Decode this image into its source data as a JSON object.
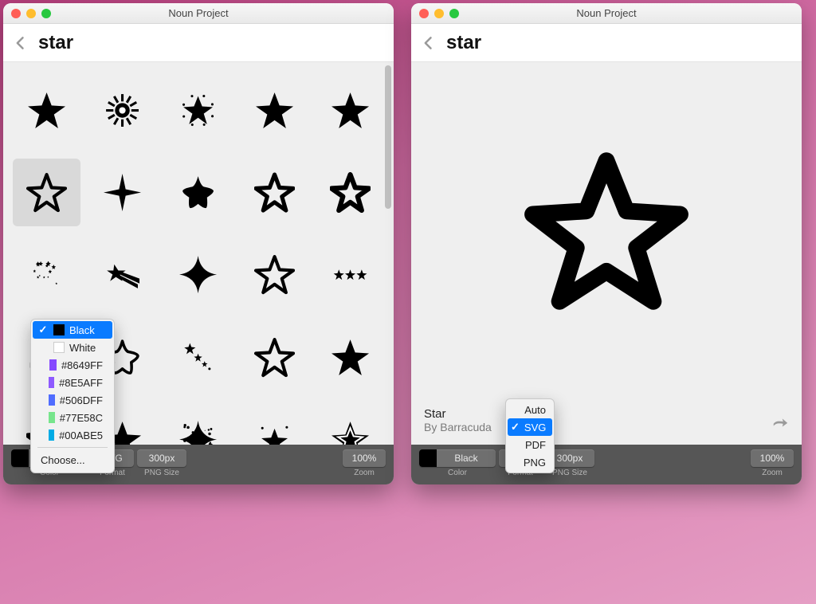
{
  "app": {
    "title": "Noun Project"
  },
  "search": {
    "term": "star",
    "back_aria": "Back"
  },
  "grid": {
    "selected_index": 5,
    "items": [
      {
        "name": "star-solid"
      },
      {
        "name": "star-sunburst"
      },
      {
        "name": "star-glow"
      },
      {
        "name": "star-solid-2"
      },
      {
        "name": "star-solid-3"
      },
      {
        "name": "star-outline"
      },
      {
        "name": "star-4point"
      },
      {
        "name": "star-rounded"
      },
      {
        "name": "star-outline-small"
      },
      {
        "name": "star-outline-bold"
      },
      {
        "name": "star-cluster"
      },
      {
        "name": "star-shooting"
      },
      {
        "name": "star-4point-concave"
      },
      {
        "name": "star-outline-3"
      },
      {
        "name": "star-rating-3"
      },
      {
        "name": "star-badge-row"
      },
      {
        "name": "star-rounded-outline"
      },
      {
        "name": "star-trail"
      },
      {
        "name": "star-outline-4"
      },
      {
        "name": "star-solid-4"
      },
      {
        "name": "star-outline-thick"
      },
      {
        "name": "star-solid-5"
      },
      {
        "name": "star-sparkle"
      },
      {
        "name": "star-with-dots"
      },
      {
        "name": "star-inset"
      }
    ]
  },
  "detail": {
    "icon_name": "Star",
    "author_prefix": "By ",
    "author": "Barracuda"
  },
  "toolbar": {
    "color": {
      "label": "Color",
      "value": "Black",
      "swatch": "#000000"
    },
    "format": {
      "label": "Format",
      "value": "SVG"
    },
    "png_size": {
      "label": "PNG Size",
      "value": "300px"
    },
    "zoom": {
      "label": "Zoom",
      "value": "100%"
    }
  },
  "color_menu": {
    "selected": "Black",
    "options": [
      {
        "label": "Black",
        "swatch": "#000000"
      },
      {
        "label": "White",
        "swatch": "#FFFFFF"
      },
      {
        "label": "#8649FF",
        "swatch": "#8649FF"
      },
      {
        "label": "#8E5AFF",
        "swatch": "#8E5AFF"
      },
      {
        "label": "#506DFF",
        "swatch": "#506DFF"
      },
      {
        "label": "#77E58C",
        "swatch": "#77E58C"
      },
      {
        "label": "#00ABE5",
        "swatch": "#00ABE5"
      }
    ],
    "choose_label": "Choose..."
  },
  "format_menu": {
    "selected": "SVG",
    "options": [
      "Auto",
      "SVG",
      "PDF",
      "PNG"
    ]
  }
}
